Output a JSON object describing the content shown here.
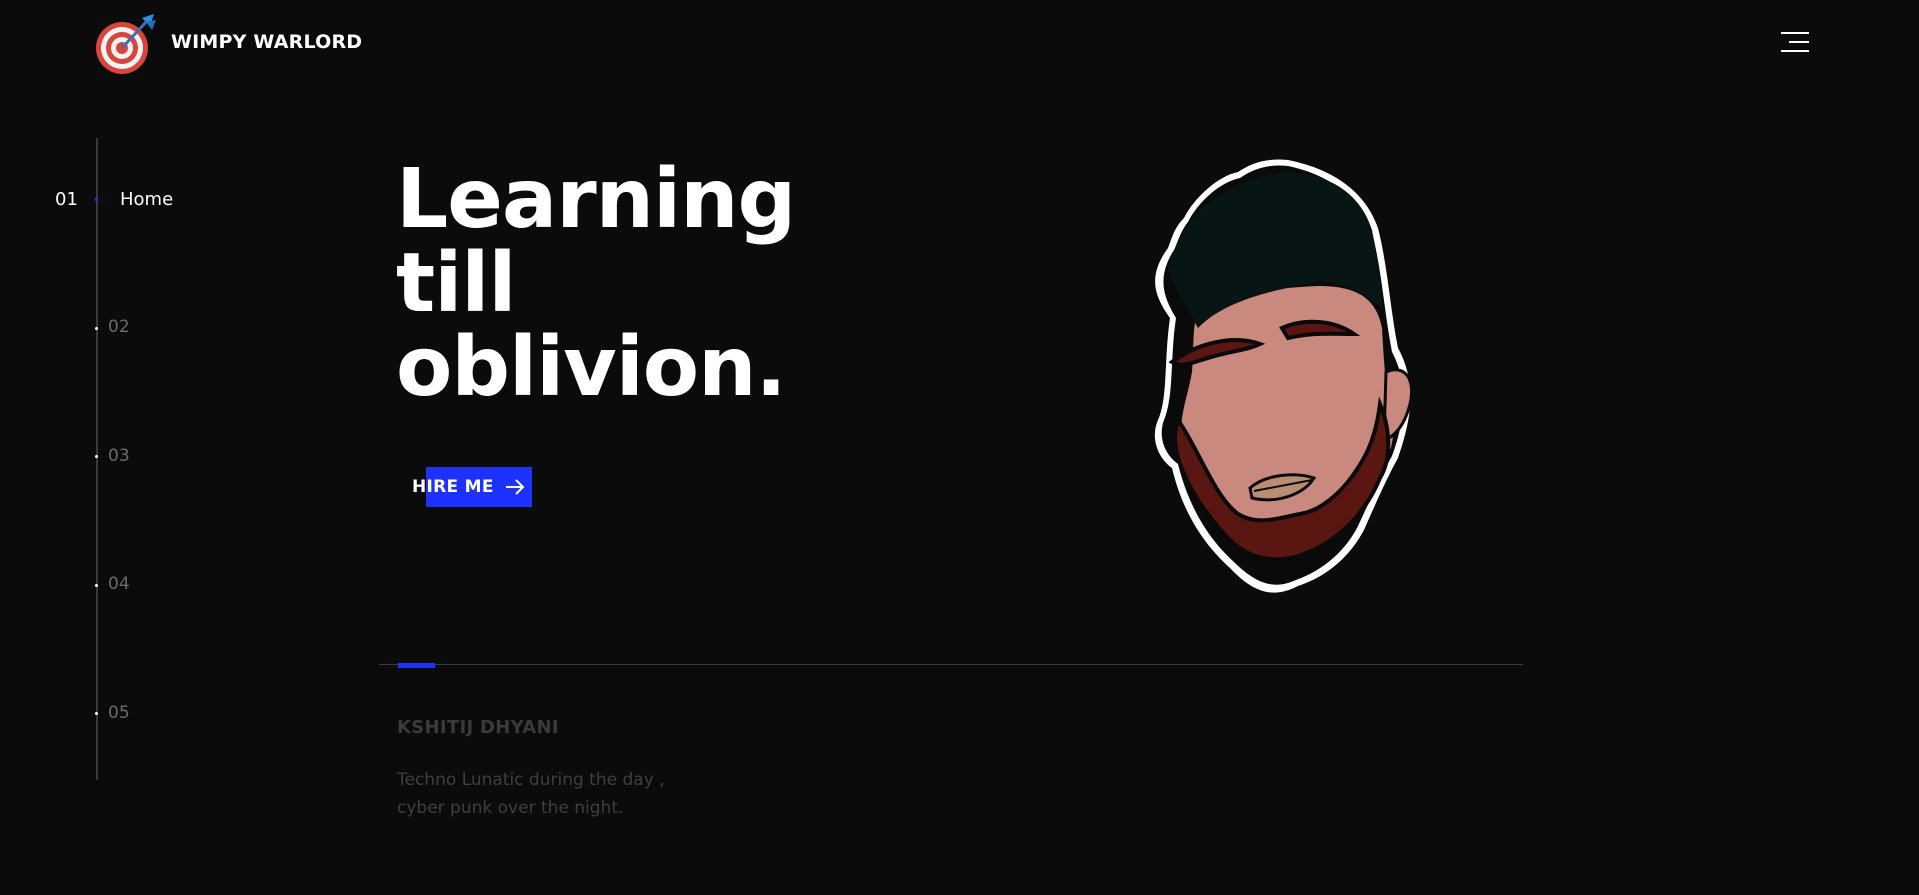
{
  "header": {
    "brand": "WIMPY WARLORD",
    "logo_icon": "target-dart-icon",
    "menu_icon": "hamburger-menu-icon"
  },
  "section_nav": {
    "active": {
      "number": "01",
      "label": "Home"
    },
    "items": [
      "02",
      "03",
      "04",
      "05"
    ]
  },
  "hero": {
    "title_lines": [
      "Learning",
      "till",
      "oblivion."
    ],
    "cta_label": "HIRE ME",
    "cta_icon": "arrow-right-icon",
    "avatar": "cartoon-face-avatar"
  },
  "intro": {
    "name": "KSHITIJ DHYANI",
    "tagline_lines": [
      "Techno Lunatic during the day ,",
      "cyber punk over the night."
    ]
  },
  "colors": {
    "background": "#0b0b0c",
    "accent": "#1e32ff",
    "text": "#ffffff",
    "muted": "#3a3a3d"
  }
}
